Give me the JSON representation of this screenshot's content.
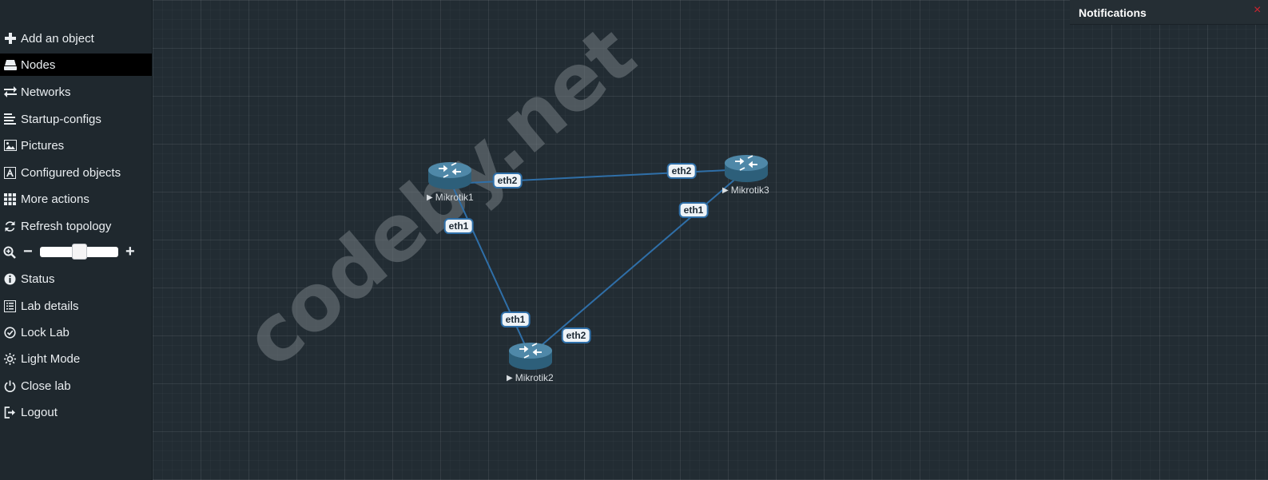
{
  "sidebar": {
    "items": [
      {
        "label": "Add an object",
        "icon": "plus-icon"
      },
      {
        "label": "Nodes",
        "icon": "hdd-icon",
        "active": true
      },
      {
        "label": "Networks",
        "icon": "exchange-icon"
      },
      {
        "label": "Startup-configs",
        "icon": "align-left-icon"
      },
      {
        "label": "Pictures",
        "icon": "picture-icon"
      },
      {
        "label": "Configured objects",
        "icon": "font-icon"
      },
      {
        "label": "More actions",
        "icon": "grid-icon"
      },
      {
        "label": "Refresh topology",
        "icon": "refresh-icon"
      },
      {
        "label": "Status",
        "icon": "info-icon"
      },
      {
        "label": "Lab details",
        "icon": "list-icon"
      },
      {
        "label": "Lock Lab",
        "icon": "check-circle-icon"
      },
      {
        "label": "Light Mode",
        "icon": "sun-icon"
      },
      {
        "label": "Close lab",
        "icon": "power-icon"
      },
      {
        "label": "Logout",
        "icon": "logout-icon"
      }
    ],
    "zoom": {
      "minus": "−",
      "plus": "+",
      "level": 0.5
    }
  },
  "topology": {
    "watermark": "codeby.net",
    "nodes": [
      {
        "name": "Mikrotik1",
        "play": "▶"
      },
      {
        "name": "Mikrotik2",
        "play": "▶"
      },
      {
        "name": "Mikrotik3",
        "play": "▶"
      }
    ],
    "interfaces": {
      "m1_eth2": "eth2",
      "m1_eth1": "eth1",
      "m3_eth2": "eth2",
      "m3_eth1": "eth1",
      "m2_eth1": "eth1",
      "m2_eth2": "eth2"
    },
    "link_color": "#2f6fa8"
  },
  "notifications": {
    "title": "Notifications",
    "close": "×"
  },
  "colors": {
    "sidebar_bg": "#1f282e",
    "canvas_bg": "#222c33",
    "active_bg": "#000000",
    "close_red": "#d0232f"
  }
}
